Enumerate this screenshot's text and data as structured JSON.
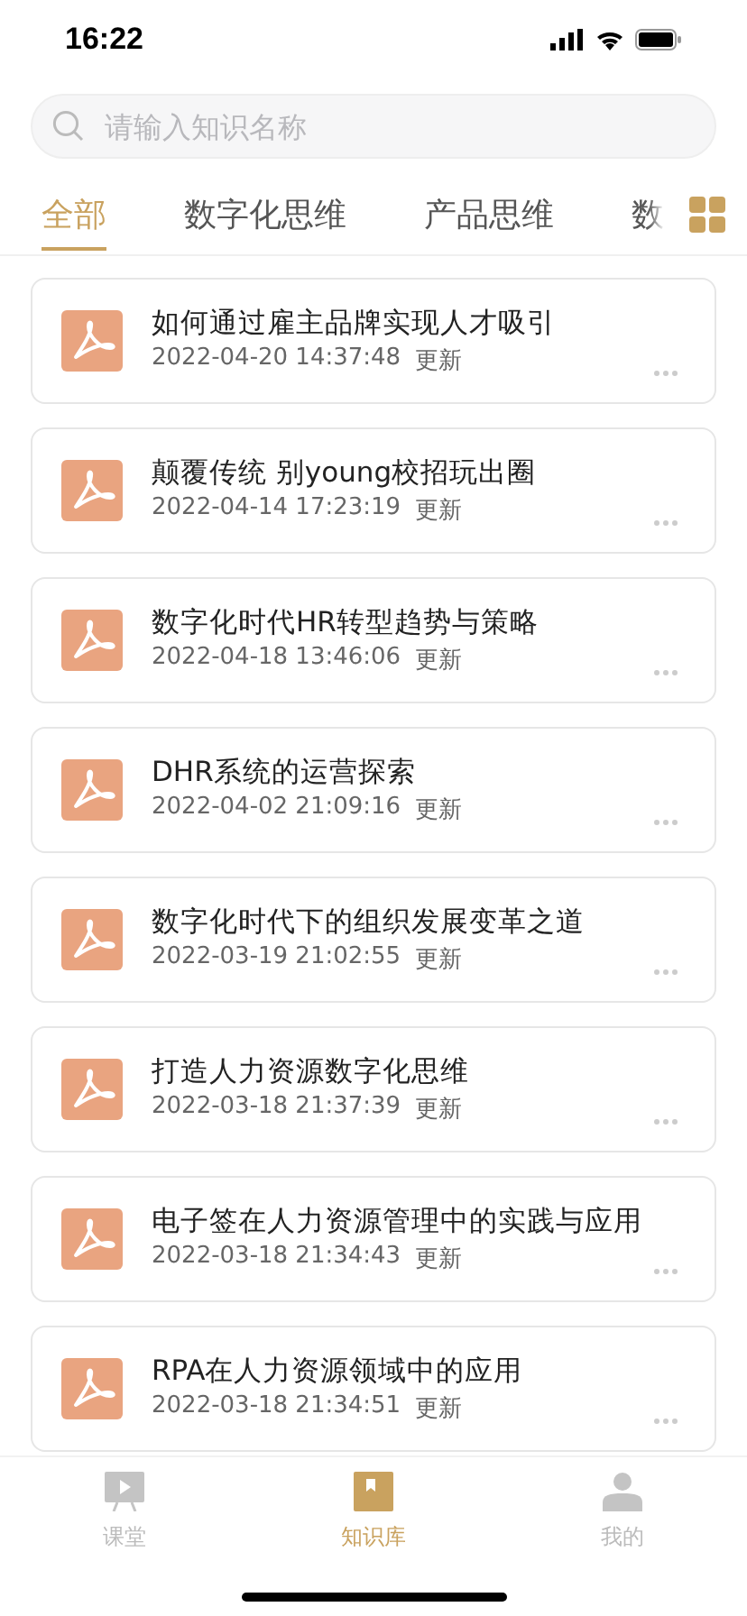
{
  "status_bar": {
    "time": "16:22"
  },
  "search": {
    "placeholder": "请输入知识名称"
  },
  "tabs": [
    {
      "label": "全部",
      "selected": true
    },
    {
      "label": "数字化思维",
      "selected": false
    },
    {
      "label": "产品思维",
      "selected": false
    },
    {
      "label": "数",
      "selected": false
    }
  ],
  "items": [
    {
      "title": "如何通过雇主品牌实现人才吸引",
      "time": "2022-04-20 14:37:48",
      "note": "更新"
    },
    {
      "title": "颠覆传统 别young校招玩出圈",
      "time": "2022-04-14 17:23:19",
      "note": "更新"
    },
    {
      "title": "数字化时代HR转型趋势与策略",
      "time": "2022-04-18 13:46:06",
      "note": "更新"
    },
    {
      "title": "DHR系统的运营探索",
      "time": "2022-04-02 21:09:16",
      "note": "更新"
    },
    {
      "title": "数字化时代下的组织发展变革之道",
      "time": "2022-03-19 21:02:55",
      "note": "更新"
    },
    {
      "title": "打造人力资源数字化思维",
      "time": "2022-03-18 21:37:39",
      "note": "更新"
    },
    {
      "title": "电子签在人力资源管理中的实践与应用",
      "time": "2022-03-18 21:34:43",
      "note": "更新"
    },
    {
      "title": "RPA在人力资源领域中的应用",
      "time": "2022-03-18 21:34:51",
      "note": "更新"
    }
  ],
  "bottom_nav": [
    {
      "label": "课堂",
      "kind": "classroom",
      "selected": false
    },
    {
      "label": "知识库",
      "kind": "library",
      "selected": true
    },
    {
      "label": "我的",
      "kind": "profile",
      "selected": false
    }
  ]
}
